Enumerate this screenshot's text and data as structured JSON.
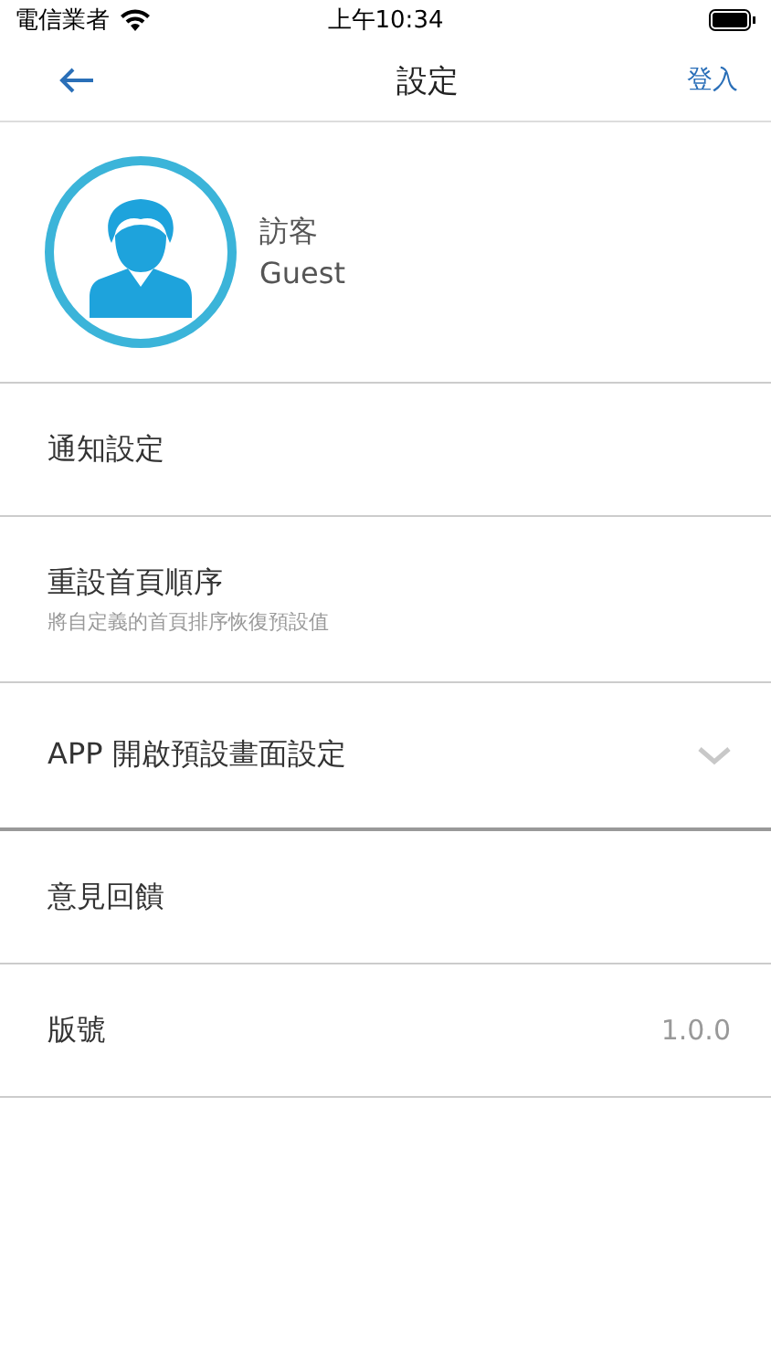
{
  "status_bar": {
    "carrier": "電信業者",
    "time": "上午10:34"
  },
  "nav": {
    "title": "設定",
    "action": "登入"
  },
  "profile": {
    "name": "訪客",
    "subtitle": "Guest"
  },
  "rows": [
    {
      "kind": "plain",
      "label": "通知設定"
    },
    {
      "kind": "subtitle",
      "label": "重設首頁順序",
      "subtitle": "將自定義的首頁排序恢復預設值"
    },
    {
      "kind": "dropdown",
      "label": "APP 開啟預設畫面設定",
      "expanded": false
    },
    {
      "kind": "plain",
      "label": "意見回饋"
    },
    {
      "kind": "value",
      "label": "版號",
      "value": "1.0.0"
    }
  ]
}
